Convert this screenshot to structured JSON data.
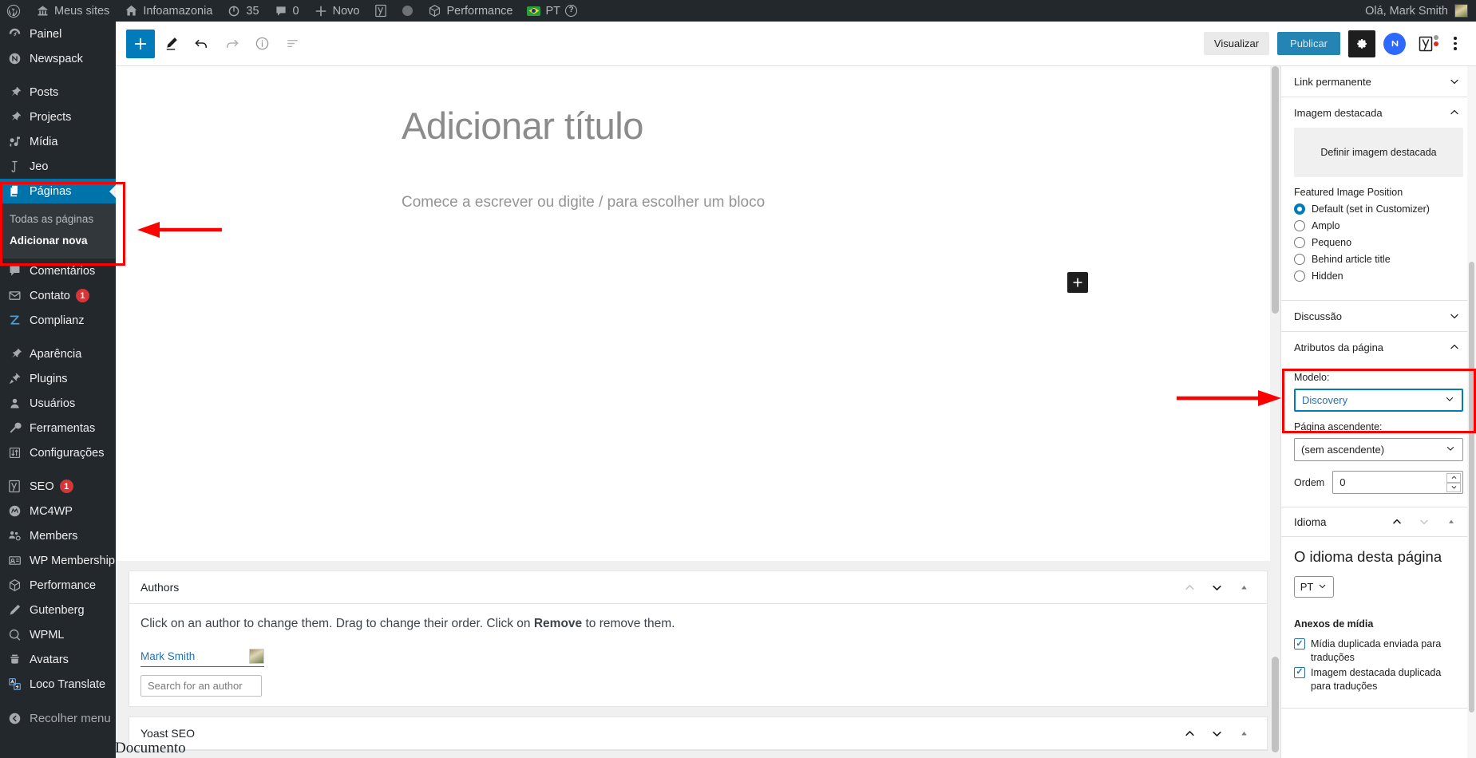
{
  "adminbar": {
    "items": [
      {
        "icon": "wordpress-logo-icon",
        "label": ""
      },
      {
        "icon": "sites-icon",
        "label": "Meus sites"
      },
      {
        "icon": "home-icon",
        "label": "Infoamazonia"
      },
      {
        "icon": "update-icon",
        "label": "35"
      },
      {
        "icon": "comment-icon",
        "label": "0"
      },
      {
        "icon": "plus-icon",
        "label": "Novo"
      },
      {
        "icon": "yoast-icon",
        "label": ""
      },
      {
        "icon": "dot-icon",
        "label": ""
      },
      {
        "icon": "performance-icon",
        "label": "Performance"
      },
      {
        "icon": "brazil-flag-icon",
        "label": "PT"
      },
      {
        "icon": "help-icon",
        "label": ""
      }
    ],
    "greeting": "Olá, Mark Smith"
  },
  "sidebar": {
    "items": [
      {
        "label": "Painel",
        "icon": "dashboard-icon",
        "gap_after": false
      },
      {
        "label": "Newspack",
        "icon": "newspack-icon",
        "gap_after": true
      },
      {
        "label": "Posts",
        "icon": "pin-icon",
        "gap_after": false
      },
      {
        "label": "Projects",
        "icon": "pin-icon",
        "gap_after": false
      },
      {
        "label": "Mídia",
        "icon": "media-icon",
        "gap_after": false
      },
      {
        "label": "Jeo",
        "icon": "jeo-icon",
        "gap_after": false
      },
      {
        "label": "Páginas",
        "icon": "pages-icon",
        "current": true,
        "gap_after": false
      },
      {
        "label": "Comentários",
        "icon": "comment-icon",
        "gap_after": false
      },
      {
        "label": "Contato",
        "icon": "mail-icon",
        "badge": "1",
        "gap_after": false
      },
      {
        "label": "Complianz",
        "icon": "complianz-icon",
        "gap_after": true
      },
      {
        "label": "Aparência",
        "icon": "appearance-icon",
        "gap_after": false
      },
      {
        "label": "Plugins",
        "icon": "plugins-icon",
        "gap_after": false
      },
      {
        "label": "Usuários",
        "icon": "users-icon",
        "gap_after": false
      },
      {
        "label": "Ferramentas",
        "icon": "tools-icon",
        "gap_after": false
      },
      {
        "label": "Configurações",
        "icon": "settings-icon",
        "gap_after": true
      },
      {
        "label": "SEO",
        "icon": "yoast-icon",
        "badge": "1",
        "gap_after": false
      },
      {
        "label": "MC4WP",
        "icon": "mailchimp-icon",
        "gap_after": false
      },
      {
        "label": "Members",
        "icon": "members-icon",
        "gap_after": false
      },
      {
        "label": "WP Membership",
        "icon": "membership-card-icon",
        "gap_after": false
      },
      {
        "label": "Performance",
        "icon": "performance-icon",
        "gap_after": false
      },
      {
        "label": "Gutenberg",
        "icon": "pencil-icon",
        "gap_after": false
      },
      {
        "label": "WPML",
        "icon": "wpml-icon",
        "gap_after": false
      },
      {
        "label": "Avatars",
        "icon": "avatar-icon",
        "gap_after": false
      },
      {
        "label": "Loco Translate",
        "icon": "translate-icon",
        "gap_after": false
      }
    ],
    "submenu": [
      {
        "label": "Todas as páginas",
        "current": false
      },
      {
        "label": "Adicionar nova",
        "current": true
      }
    ],
    "collapse_label": "Recolher menu"
  },
  "editor_toolbar": {
    "add_block_title": "add-block",
    "tools": [
      "edit-pencil",
      "undo",
      "redo",
      "info",
      "list-view"
    ],
    "preview_label": "Visualizar",
    "publish_label": "Publicar"
  },
  "canvas": {
    "title_placeholder": "Adicionar título",
    "block_prompt": "Comece a escrever ou digite / para escolher um bloco"
  },
  "metaboxes": {
    "documento_label": "Documento",
    "authors": {
      "title": "Authors",
      "help_part1": "Click on an author to change them. Drag to change their order. Click on ",
      "help_bold": "Remove",
      "help_part2": " to remove them.",
      "author_name": "Mark Smith",
      "search_placeholder": "Search for an author"
    },
    "yoast": {
      "title": "Yoast SEO"
    }
  },
  "settings": {
    "permalink": {
      "title": "Link permanente"
    },
    "featured_image": {
      "title": "Imagem destacada",
      "set_label": "Definir imagem destacada",
      "position_label": "Featured Image Position",
      "options": [
        {
          "label": "Default (set in Customizer)",
          "checked": true
        },
        {
          "label": "Amplo",
          "checked": false
        },
        {
          "label": "Pequeno",
          "checked": false
        },
        {
          "label": "Behind article title",
          "checked": false
        },
        {
          "label": "Hidden",
          "checked": false
        }
      ]
    },
    "discussion": {
      "title": "Discussão"
    },
    "page_attributes": {
      "title": "Atributos da página",
      "template_label": "Modelo:",
      "template_value": "Discovery",
      "parent_label": "Página ascendente:",
      "parent_value": "(sem ascendente)",
      "order_label": "Ordem",
      "order_value": "0"
    },
    "language": {
      "title": "Idioma",
      "heading": "O idioma desta página",
      "current": "PT",
      "media_title": "Anexos de mídia",
      "checkboxes": [
        {
          "label": "Mídia duplicada enviada para traduções",
          "checked": true
        },
        {
          "label": "Imagem destacada duplicada para traduções",
          "checked": true
        }
      ]
    }
  },
  "annotations": {
    "accent_color": "#ff0000",
    "highlight_sidebar": "Páginas submenu highlighted",
    "highlight_template": "Modelo / Discovery select highlighted"
  }
}
